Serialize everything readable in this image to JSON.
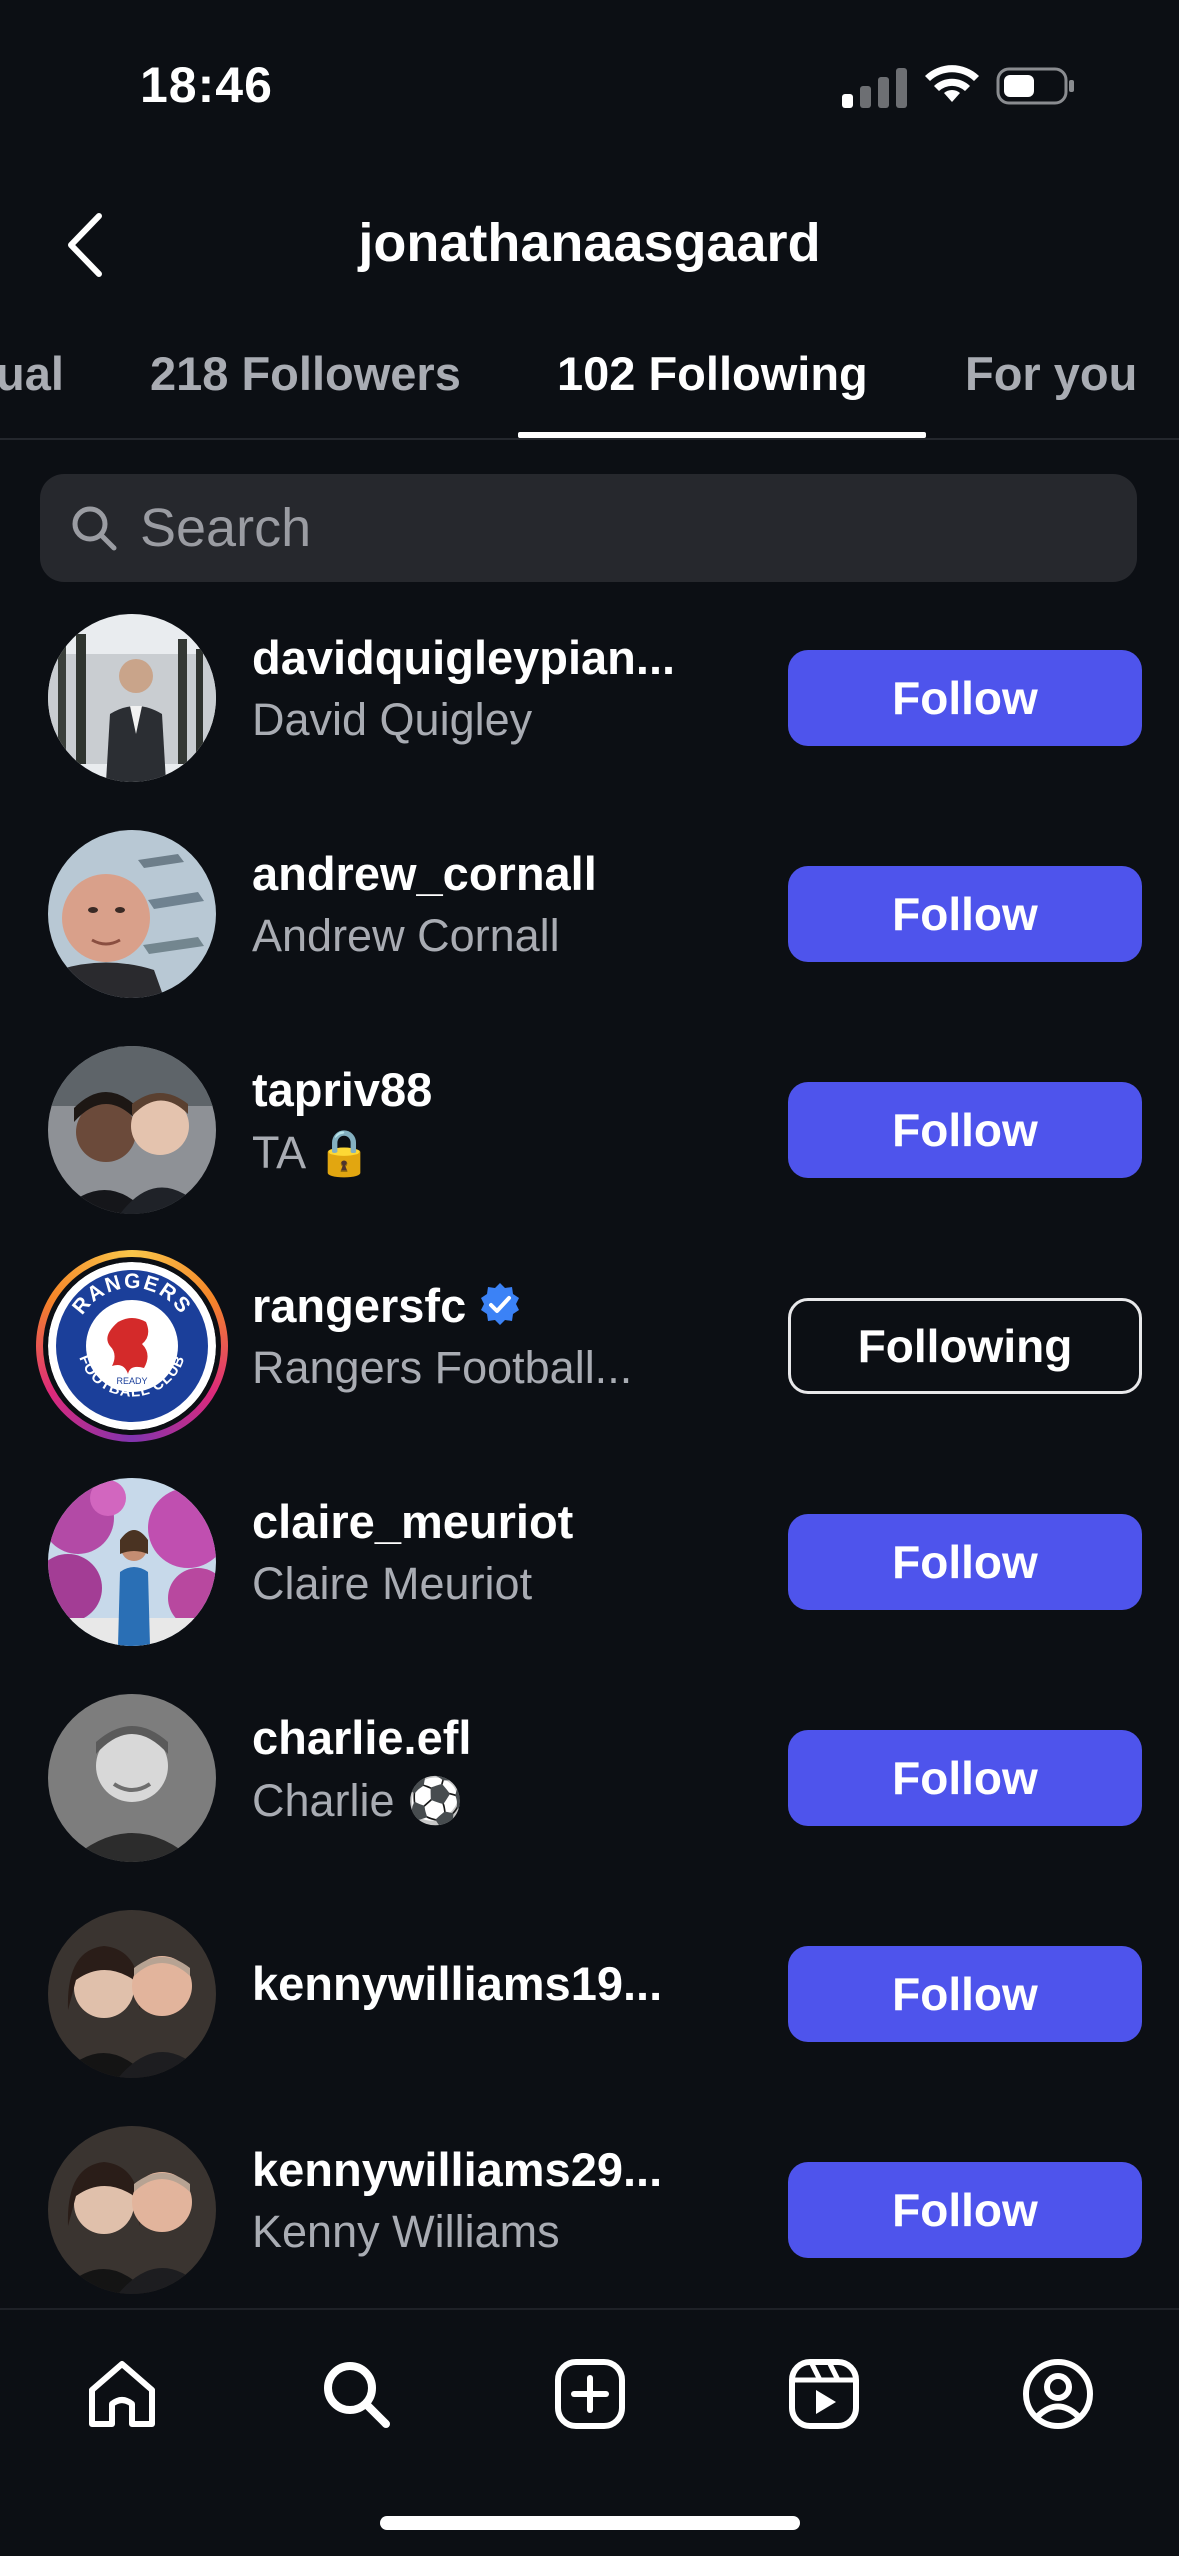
{
  "status_bar": {
    "time": "18:46"
  },
  "header": {
    "title": "jonathanaasgaard"
  },
  "tabs": [
    {
      "label": "ual",
      "active": false
    },
    {
      "label": "218 Followers",
      "active": false
    },
    {
      "label": "102 Following",
      "active": true
    },
    {
      "label": "For you",
      "active": false
    }
  ],
  "search": {
    "placeholder": "Search",
    "value": ""
  },
  "users": [
    {
      "username": "davidquigleypian...",
      "full_name": "David Quigley",
      "button": "Follow",
      "following": false,
      "verified": false,
      "avatar": "man-in-suit-trees-photo"
    },
    {
      "username": "andrew_cornall",
      "full_name": "Andrew Cornall",
      "button": "Follow",
      "following": false,
      "verified": false,
      "avatar": "man-with-aircraft-photo"
    },
    {
      "username": "tapriv88",
      "full_name": "TA 🔒",
      "button": "Follow",
      "following": false,
      "verified": false,
      "avatar": "couple-selfie-photo"
    },
    {
      "username": "rangersfc",
      "full_name": "Rangers Football...",
      "button": "Following",
      "following": true,
      "verified": true,
      "avatar": "rangers-crest-logo"
    },
    {
      "username": "claire_meuriot",
      "full_name": "Claire Meuriot",
      "button": "Follow",
      "following": false,
      "verified": false,
      "avatar": "woman-flowers-photo"
    },
    {
      "username": "charlie.efl",
      "full_name": "Charlie ⚽",
      "button": "Follow",
      "following": false,
      "verified": false,
      "avatar": "bw-portrait-photo"
    },
    {
      "username": "kennywilliams19...",
      "full_name": "",
      "button": "Follow",
      "following": false,
      "verified": false,
      "avatar": "couple-photo"
    },
    {
      "username": "kennywilliams29...",
      "full_name": "Kenny Williams",
      "button": "Follow",
      "following": false,
      "verified": false,
      "avatar": "couple-photo"
    }
  ],
  "rangers_logo_text": {
    "top": "RANGERS",
    "bottom": "FOOTBALL CLUB",
    "middle": "READY"
  },
  "bottom_nav": [
    "home-icon",
    "search-icon",
    "create-icon",
    "reels-icon",
    "profile-icon"
  ],
  "colors": {
    "background": "#0c0f14",
    "follow_button": "#4e54ec",
    "verified": "#3b82f6",
    "secondary_text": "#a9acb3"
  }
}
